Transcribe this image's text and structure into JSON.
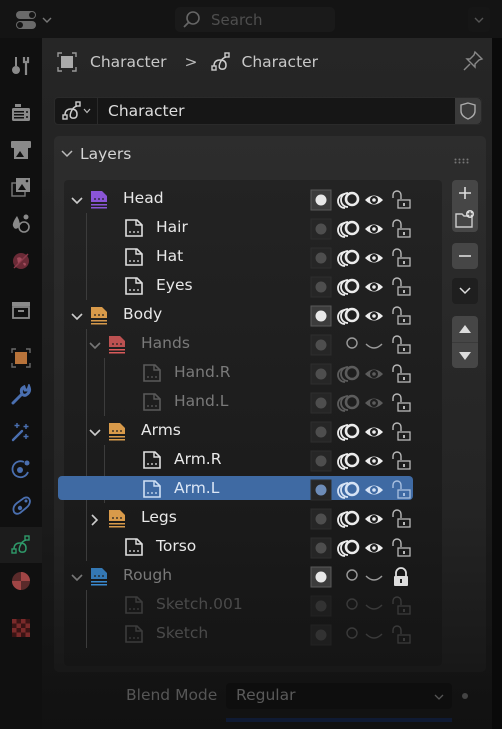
{
  "topbar": {
    "search_placeholder": "Search"
  },
  "breadcrumb": {
    "object_name": "Character",
    "separator": ">",
    "data_name": "Character"
  },
  "datablock": {
    "name": "Character"
  },
  "panel": {
    "title": "Layers"
  },
  "sidebar": {
    "items": [
      {
        "name": "tool",
        "color": "#8a8a8a"
      },
      {
        "name": "render",
        "color": "#8a8a8a"
      },
      {
        "name": "output",
        "color": "#8a8a8a"
      },
      {
        "name": "view-layer",
        "color": "#8a8a8a"
      },
      {
        "name": "scene",
        "color": "#8a8a8a"
      },
      {
        "name": "world",
        "color": "#8c3a4a"
      },
      {
        "name": "collection",
        "color": "#8a8a8a"
      },
      {
        "name": "object",
        "color": "#c07a3a"
      },
      {
        "name": "modifiers",
        "color": "#4a6fb0"
      },
      {
        "name": "effects",
        "color": "#4a6fb0"
      },
      {
        "name": "physics",
        "color": "#4a6fb0"
      },
      {
        "name": "constraints",
        "color": "#4a6fb0"
      },
      {
        "name": "object-data",
        "color": "#2f9a6a",
        "active": true
      },
      {
        "name": "material",
        "color": "#8c3a3a"
      },
      {
        "name": "texture",
        "color": "#7a2a2a"
      }
    ]
  },
  "colors": {
    "head_group": "#8a55d6",
    "body_group": "#d89a4a",
    "hands_group": "#d85a5a",
    "arms_group": "#d89a4a",
    "legs_group": "#d89a4a",
    "rough_group": "#3a8ad0",
    "selection": "#3f6aa3"
  },
  "layers": [
    {
      "label": "Head",
      "depth": 0,
      "type": "group",
      "color": "head_group",
      "expanded": true,
      "mask_active": true,
      "onion": true,
      "visible": true,
      "locked": false,
      "dim": false
    },
    {
      "label": "Hair",
      "depth": 1,
      "type": "layer",
      "mask_active": false,
      "onion": true,
      "visible": true,
      "locked": false,
      "dim": false
    },
    {
      "label": "Hat",
      "depth": 1,
      "type": "layer",
      "mask_active": false,
      "onion": true,
      "visible": true,
      "locked": false,
      "dim": false
    },
    {
      "label": "Eyes",
      "depth": 1,
      "type": "layer",
      "mask_active": false,
      "onion": true,
      "visible": true,
      "locked": false,
      "dim": false
    },
    {
      "label": "Body",
      "depth": 0,
      "type": "group",
      "color": "body_group",
      "expanded": true,
      "mask_active": true,
      "onion": true,
      "visible": true,
      "locked": false,
      "dim": false
    },
    {
      "label": "Hands",
      "depth": 1,
      "type": "group",
      "color": "hands_group",
      "expanded": true,
      "mask_active": false,
      "onion": false,
      "visible": false,
      "locked": false,
      "dim": true
    },
    {
      "label": "Hand.R",
      "depth": 2,
      "type": "layer",
      "mask_active": false,
      "onion": true,
      "visible": true,
      "locked": false,
      "dim": true
    },
    {
      "label": "Hand.L",
      "depth": 2,
      "type": "layer",
      "mask_active": false,
      "onion": true,
      "visible": true,
      "locked": false,
      "dim": true
    },
    {
      "label": "Arms",
      "depth": 1,
      "type": "group",
      "color": "arms_group",
      "expanded": true,
      "mask_active": false,
      "onion": true,
      "visible": true,
      "locked": false,
      "dim": false
    },
    {
      "label": "Arm.R",
      "depth": 2,
      "type": "layer",
      "mask_active": false,
      "onion": true,
      "visible": true,
      "locked": false,
      "dim": false
    },
    {
      "label": "Arm.L",
      "depth": 2,
      "type": "layer",
      "mask_active": false,
      "onion": true,
      "visible": true,
      "locked": false,
      "dim": false,
      "selected": true
    },
    {
      "label": "Legs",
      "depth": 1,
      "type": "group",
      "color": "legs_group",
      "expanded": false,
      "mask_active": false,
      "onion": true,
      "visible": true,
      "locked": false,
      "dim": false
    },
    {
      "label": "Torso",
      "depth": 1,
      "type": "layer",
      "mask_active": false,
      "onion": true,
      "visible": true,
      "locked": false,
      "dim": false
    },
    {
      "label": "Rough",
      "depth": 0,
      "type": "group",
      "color": "rough_group",
      "expanded": true,
      "mask_active": true,
      "onion": false,
      "visible": false,
      "locked": true,
      "dim": true
    },
    {
      "label": "Sketch.001",
      "depth": 1,
      "type": "layer",
      "mask_active": false,
      "onion": false,
      "visible": false,
      "locked": false,
      "dim": true,
      "very_dim": true
    },
    {
      "label": "Sketch",
      "depth": 1,
      "type": "layer",
      "mask_active": false,
      "onion": false,
      "visible": false,
      "locked": false,
      "dim": true,
      "very_dim": true
    }
  ],
  "side_buttons": [
    {
      "name": "add-layer",
      "glyph": "+"
    },
    {
      "name": "add-group",
      "glyph": "folder+"
    },
    {
      "name": "remove-layer",
      "glyph": "−"
    },
    {
      "name": "specials-menu",
      "glyph": "v"
    },
    {
      "name": "move-up",
      "glyph": "▲"
    },
    {
      "name": "move-down",
      "glyph": "▼"
    }
  ],
  "blend_mode": {
    "label": "Blend Mode",
    "value": "Regular"
  }
}
